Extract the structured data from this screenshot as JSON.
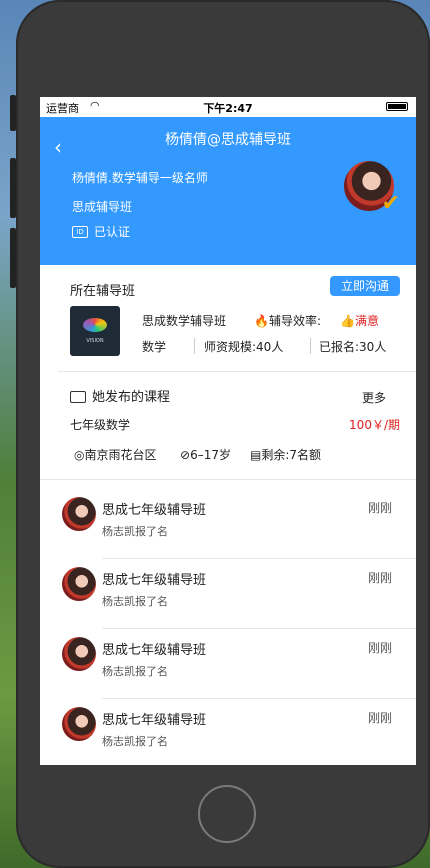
{
  "status_bar": {
    "carrier": "运营商",
    "time": "下午2:47"
  },
  "header": {
    "title": "杨倩倩@思成辅导班",
    "line1": "杨倩倩.数学辅导一级名师",
    "line2": "思成辅导班",
    "verified": "已认证",
    "id_icon": "ID"
  },
  "class_section": {
    "title": "所在辅导班",
    "chat_button": "立即沟通",
    "name": "思成数学辅导班",
    "efficiency_label": "辅导效率:",
    "efficiency_value": "满意",
    "subject": "数学",
    "faculty": "师资规模:40人",
    "enrolled": "已报名:30人",
    "logo_text": "VISION"
  },
  "courses": {
    "title": "她发布的课程",
    "more": "更多",
    "course_name": "七年级数学",
    "price": "100￥/期",
    "location": "南京雨花台区",
    "age": "6–17岁",
    "remaining": "剩余:7名额"
  },
  "feed": [
    {
      "title": "思成七年级辅导班",
      "sub": "杨志凯报了名",
      "time": "刚刚"
    },
    {
      "title": "思成七年级辅导班",
      "sub": "杨志凯报了名",
      "time": "刚刚"
    },
    {
      "title": "思成七年级辅导班",
      "sub": "杨志凯报了名",
      "time": "刚刚"
    },
    {
      "title": "思成七年级辅导班",
      "sub": "杨志凯报了名",
      "time": "刚刚"
    }
  ],
  "colors": {
    "accent": "#3399ff",
    "price_red": "#e02020",
    "badge_gold": "#f2a900"
  },
  "icons": [
    "back-chevron-icon",
    "wifi-icon",
    "battery-icon",
    "id-card-icon",
    "verified-v-icon",
    "fire-icon",
    "thumbs-up-icon",
    "book-stack-icon",
    "location-pin-icon",
    "check-circle-icon",
    "calendar-icon"
  ]
}
